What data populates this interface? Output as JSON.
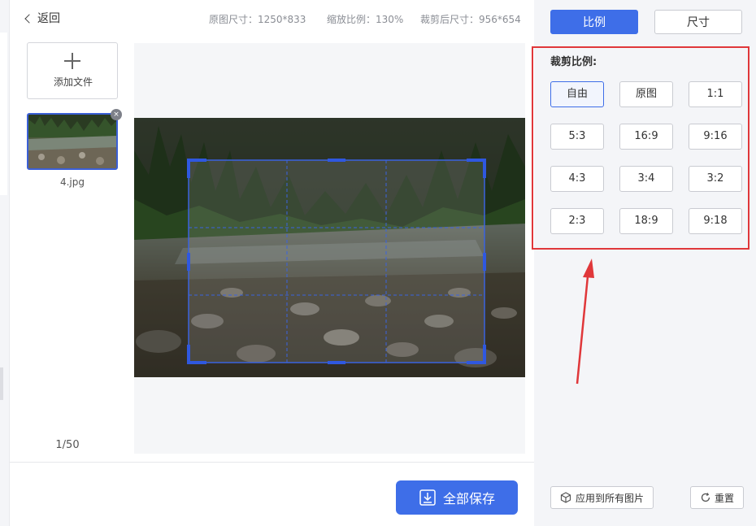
{
  "header": {
    "back_label": "返回",
    "original_size": "原图尺寸：1250*833",
    "zoom_ratio": "缩放比例：130%",
    "cropped_size": "裁剪后尺寸：956*654"
  },
  "sidebar": {
    "add_file_label": "添加文件",
    "thumbnail_name": "4.jpg",
    "page_count": "1/50",
    "remove_icon": "×"
  },
  "footer": {
    "save_all_label": "全部保存"
  },
  "panel": {
    "tabs": [
      {
        "label": "比例",
        "active": true
      },
      {
        "label": "尺寸",
        "active": false
      }
    ],
    "ratio_title": "裁剪比例:",
    "ratios": [
      {
        "label": "自由",
        "active": true
      },
      {
        "label": "原图"
      },
      {
        "label": "1:1"
      },
      {
        "label": "5:3"
      },
      {
        "label": "16:9"
      },
      {
        "label": "9:16"
      },
      {
        "label": "4:3"
      },
      {
        "label": "3:4"
      },
      {
        "label": "3:2"
      },
      {
        "label": "2:3"
      },
      {
        "label": "18:9"
      },
      {
        "label": "9:18"
      }
    ],
    "apply_all_label": "应用到所有图片",
    "reset_label": "重置"
  },
  "colors": {
    "accent": "#3e6ee8",
    "highlight_box": "#e0373a",
    "panel_bg": "#f4f5f8"
  },
  "icons": [
    "chevron-left-icon",
    "plus-icon",
    "close-icon",
    "download-icon",
    "cube-icon",
    "refresh-icon"
  ]
}
